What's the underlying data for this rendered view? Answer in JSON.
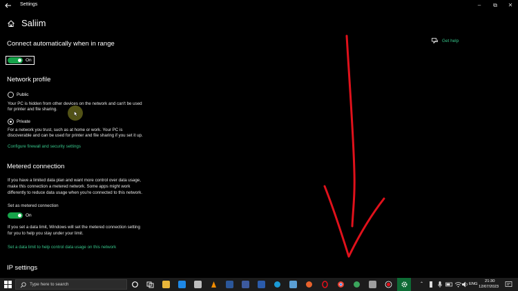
{
  "window": {
    "title": "Settings"
  },
  "page": {
    "title": "Saliim"
  },
  "help": {
    "label": "Get help",
    "icon": "chat-help-icon"
  },
  "auto_connect": {
    "heading": "Connect automatically when in range",
    "toggle_state": "On"
  },
  "network_profile": {
    "heading": "Network profile",
    "public_label": "Public",
    "public_desc_1": "Your PC is hidden from other devices on the network and can't be used",
    "public_desc_2": "for printer and file sharing.",
    "private_label": "Private",
    "private_desc_1": "For a network you trust, such as at home or work. Your PC is",
    "private_desc_2": "discoverable and can be used for printer and file sharing if you set it up.",
    "selected": "Private",
    "firewall_link": "Configure firewall and security settings"
  },
  "metered": {
    "heading": "Metered connection",
    "desc_1": "If you have a limited data plan and want more control over data usage,",
    "desc_2": "make this connection a metered network. Some apps might work",
    "desc_3": "differently to reduce data usage when you're connected to this network.",
    "toggle_label": "Set as metered connection",
    "toggle_state": "On",
    "note_1": "If you set a data limit, Windows will set the metered connection setting",
    "note_2": "for you to help you stay under your limit.",
    "data_limit_link": "Set a data limit to help control data usage on this network"
  },
  "ip_settings": {
    "heading": "IP settings"
  },
  "taskbar": {
    "search_placeholder": "Type here to search",
    "language": "ENG",
    "time": "21:30",
    "date": "12/07/2023",
    "accent": "#0e6b35"
  },
  "colors": {
    "accent": "#16a34a",
    "link": "#36c58a",
    "annotation": "#e0111b"
  }
}
